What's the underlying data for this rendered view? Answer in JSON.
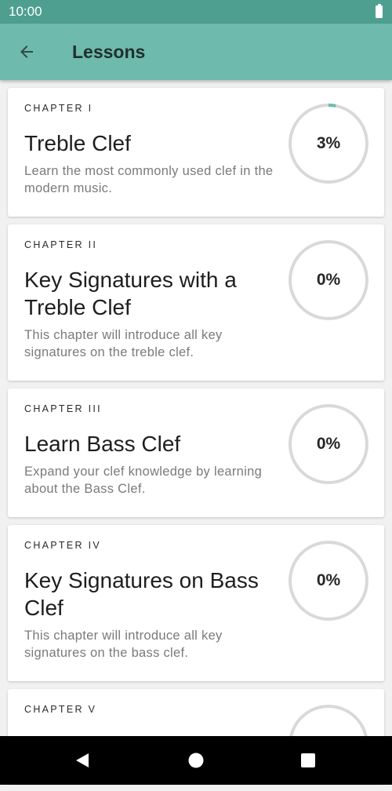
{
  "status_bar": {
    "time": "10:00"
  },
  "app_bar": {
    "title": "Lessons",
    "back_icon": "arrow-back-icon"
  },
  "colors": {
    "accent": "#6ebaac",
    "status_bar": "#4f9f90",
    "ring_track": "#d9d9d9",
    "ring_fill": "#6ebaac"
  },
  "chapters": [
    {
      "label": "CHAPTER I",
      "title": "Treble Clef",
      "description": "Learn the most commonly used clef in the modern music.",
      "progress": 3,
      "progress_text": "3%"
    },
    {
      "label": "CHAPTER II",
      "title": "Key Signatures with a Treble Clef",
      "description": "This chapter will introduce all key signatures on the treble clef.",
      "progress": 0,
      "progress_text": "0%"
    },
    {
      "label": "CHAPTER III",
      "title": "Learn Bass Clef",
      "description": "Expand your clef knowledge by learning about the Bass Clef.",
      "progress": 0,
      "progress_text": "0%"
    },
    {
      "label": "CHAPTER IV",
      "title": "Key Signatures on Bass Clef",
      "description": "This chapter will introduce all key signatures on the bass clef.",
      "progress": 0,
      "progress_text": "0%"
    },
    {
      "label": "CHAPTER V",
      "title": "",
      "description": "",
      "progress": 0,
      "progress_text": ""
    }
  ],
  "nav_bar": {
    "back_icon": "triangle-back-icon",
    "home_icon": "circle-home-icon",
    "recents_icon": "square-recents-icon"
  }
}
